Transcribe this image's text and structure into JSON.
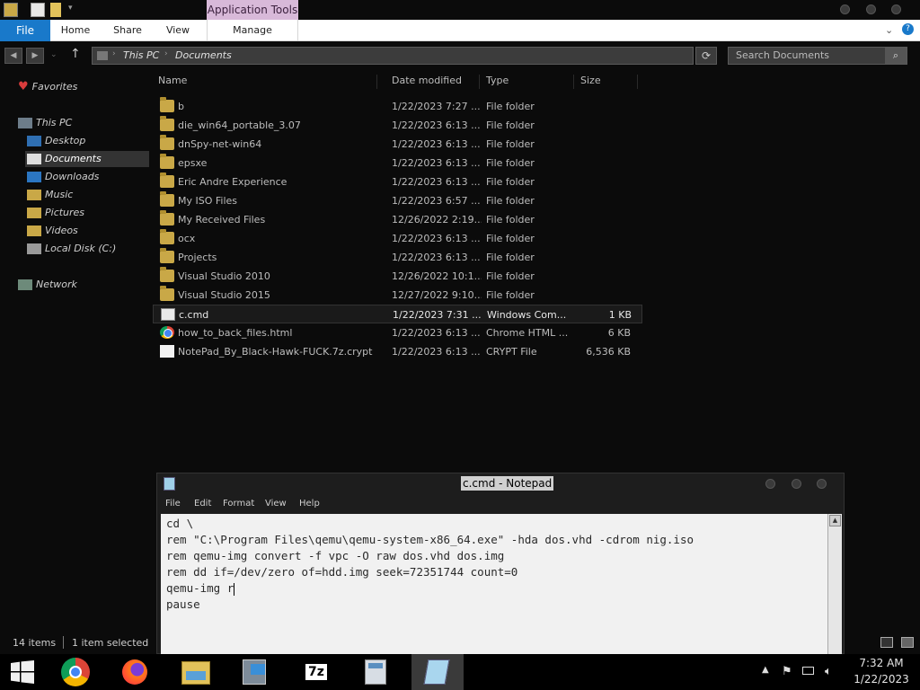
{
  "titlebar": {
    "app_tools": "Application Tools"
  },
  "ribbon": {
    "tabs": [
      "File",
      "Home",
      "Share",
      "View",
      "Manage"
    ]
  },
  "address": {
    "crumbs": [
      "This PC",
      "Documents"
    ],
    "search_placeholder": "Search Documents"
  },
  "navpane": {
    "favorites": "Favorites",
    "this_pc": "This PC",
    "items": [
      "Desktop",
      "Documents",
      "Downloads",
      "Music",
      "Pictures",
      "Videos",
      "Local Disk (C:)"
    ],
    "network": "Network"
  },
  "columns": [
    "Name",
    "Date modified",
    "Type",
    "Size"
  ],
  "files": [
    {
      "name": "b",
      "date": "1/22/2023 7:27 ...",
      "type": "File folder",
      "size": "",
      "icon": "folder-icon"
    },
    {
      "name": "die_win64_portable_3.07",
      "date": "1/22/2023 6:13 ...",
      "type": "File folder",
      "size": "",
      "icon": "folder-icon"
    },
    {
      "name": "dnSpy-net-win64",
      "date": "1/22/2023 6:13 ...",
      "type": "File folder",
      "size": "",
      "icon": "folder-icon"
    },
    {
      "name": "epsxe",
      "date": "1/22/2023 6:13 ...",
      "type": "File folder",
      "size": "",
      "icon": "folder-icon"
    },
    {
      "name": "Eric Andre Experience",
      "date": "1/22/2023 6:13 ...",
      "type": "File folder",
      "size": "",
      "icon": "folder-icon"
    },
    {
      "name": "My ISO Files",
      "date": "1/22/2023 6:57 ...",
      "type": "File folder",
      "size": "",
      "icon": "folder-icon"
    },
    {
      "name": "My Received Files",
      "date": "12/26/2022 2:19...",
      "type": "File folder",
      "size": "",
      "icon": "folder-icon"
    },
    {
      "name": "ocx",
      "date": "1/22/2023 6:13 ...",
      "type": "File folder",
      "size": "",
      "icon": "folder-icon"
    },
    {
      "name": "Projects",
      "date": "1/22/2023 6:13 ...",
      "type": "File folder",
      "size": "",
      "icon": "folder-icon"
    },
    {
      "name": "Visual Studio 2010",
      "date": "12/26/2022 10:1...",
      "type": "File folder",
      "size": "",
      "icon": "folder-icon"
    },
    {
      "name": "Visual Studio 2015",
      "date": "12/27/2022 9:10...",
      "type": "File folder",
      "size": "",
      "icon": "folder-icon"
    },
    {
      "name": "c.cmd",
      "date": "1/22/2023 7:31 ...",
      "type": "Windows Com...",
      "size": "1 KB",
      "icon": "cmd-file-icon"
    },
    {
      "name": "how_to_back_files.html",
      "date": "1/22/2023 6:13 ...",
      "type": "Chrome HTML ...",
      "size": "6 KB",
      "icon": "chrome-html-icon"
    },
    {
      "name": "NotePad_By_Black-Hawk-FUCK.7z.crypt",
      "date": "1/22/2023 6:13 ...",
      "type": "CRYPT File",
      "size": "6,536 KB",
      "icon": "crypt-file-icon"
    }
  ],
  "status": {
    "count": "14 items",
    "selected": "1 item selected"
  },
  "notepad": {
    "title": "c.cmd - Notepad",
    "menu": [
      "File",
      "Edit",
      "Format",
      "View",
      "Help"
    ],
    "lines": [
      "cd \\",
      "rem \"C:\\Program Files\\qemu\\qemu-system-x86_64.exe\" -hda dos.vhd -cdrom nig.iso",
      "rem qemu-img convert -f vpc -O raw dos.vhd dos.img",
      "rem dd if=/dev/zero of=hdd.img seek=72351744 count=0",
      "qemu-img r",
      "pause"
    ]
  },
  "taskbar": {
    "apps": [
      "start-icon",
      "chrome-icon",
      "firefox-icon",
      "file-explorer-icon",
      "network-tool-icon",
      "7zip-icon",
      "calculator-icon",
      "notepad-icon"
    ],
    "sevenzip_label": "7z",
    "time": "7:32 AM",
    "date": "1/22/2023"
  },
  "colors": {
    "file_tab": "#1979ca",
    "app_tools": "#d8b9d9"
  }
}
